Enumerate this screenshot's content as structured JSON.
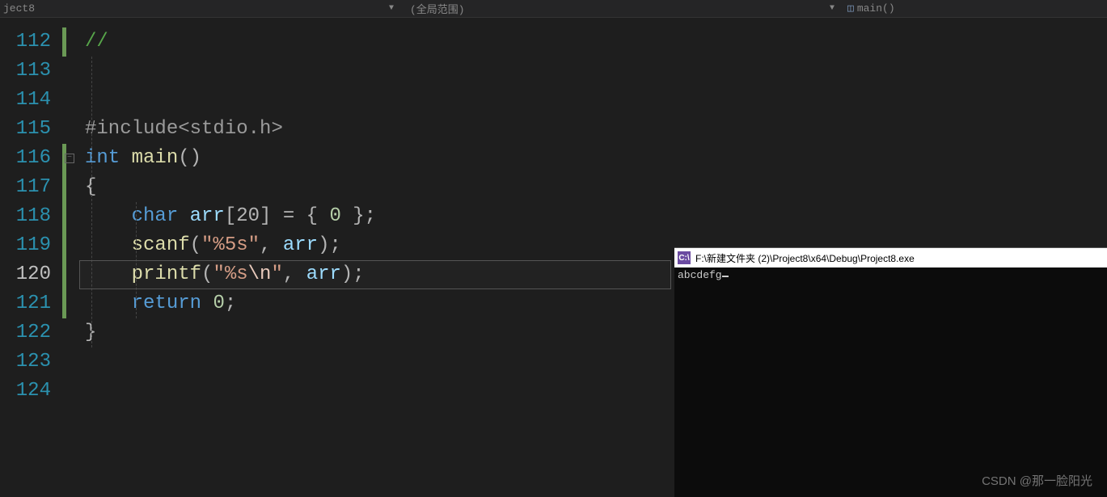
{
  "topbar": {
    "tab": "ject8",
    "scope": "(全局范围)",
    "symbol": "main()"
  },
  "gutter": {
    "lines": [
      "112",
      "113",
      "114",
      "115",
      "116",
      "117",
      "118",
      "119",
      "120",
      "121",
      "122",
      "123",
      "124"
    ],
    "current": "120"
  },
  "code": {
    "l112": {
      "comment": "//"
    },
    "l115": {
      "pre": "#include",
      "hdr": "<stdio.h>"
    },
    "l116": {
      "type": "int",
      "fn": "main",
      "paren": "()"
    },
    "l117": {
      "brace": "{"
    },
    "l118": {
      "type": "char",
      "id": "arr",
      "br": "[20] = { ",
      "num": "0",
      "tail": " };"
    },
    "l119": {
      "fn": "scanf",
      "open": "(",
      "str": "\"%5s\"",
      "mid": ", ",
      "id": "arr",
      "close": ");"
    },
    "l120": {
      "fn": "printf",
      "open": "(",
      "str1": "\"%s",
      "esc": "\\n",
      "str2": "\"",
      "mid": ", ",
      "id": "arr",
      "close": ");"
    },
    "l121": {
      "kw": "return",
      "sp": " ",
      "num": "0",
      "semi": ";"
    },
    "l122": {
      "brace": "}"
    }
  },
  "console": {
    "title": "F:\\新建文件夹 (2)\\Project8\\x64\\Debug\\Project8.exe",
    "icon": "C:\\",
    "line": "abcdefg"
  },
  "watermark": "CSDN @那一脸阳光"
}
